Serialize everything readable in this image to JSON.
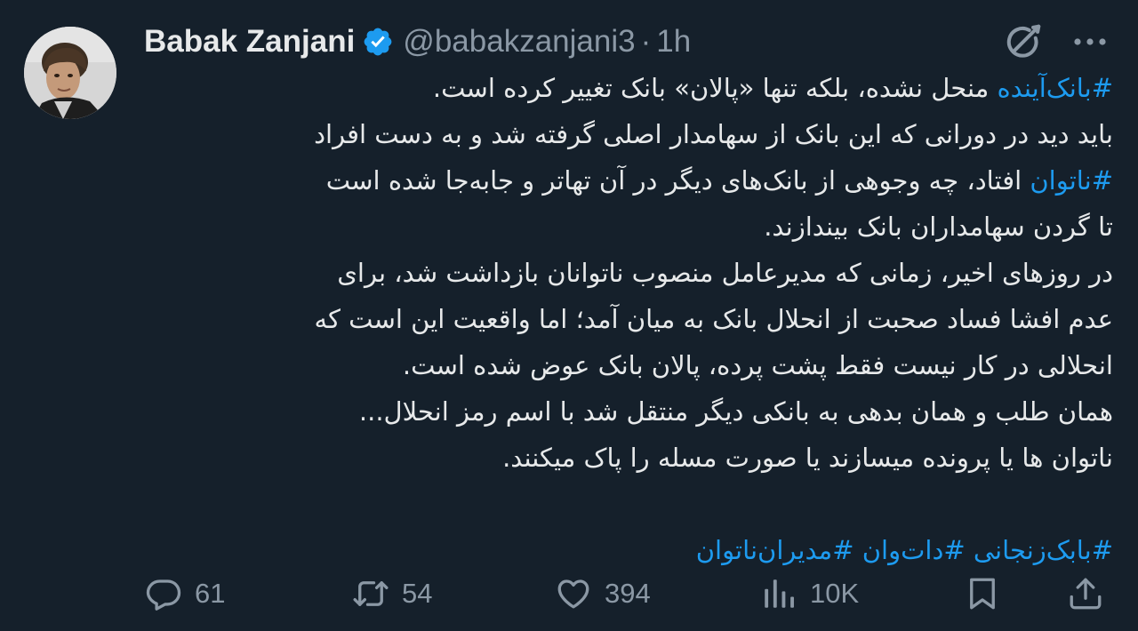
{
  "author": {
    "name": "Babak Zanjani",
    "handle": "@babakzanjani3",
    "separator": "·",
    "time": "1h",
    "verified": true
  },
  "tweet": {
    "lines": [
      [
        {
          "t": "#بانک‌آینده",
          "tag": true
        },
        {
          "t": " منحل نشده، بلکه تنها «پالان» بانک تغییر کرده است."
        }
      ],
      [
        {
          "t": "باید دید در دورانی که این بانک از سهامدار اصلی گرفته شد و به دست افراد"
        }
      ],
      [
        {
          "t": "#ناتوان",
          "tag": true
        },
        {
          "t": " افتاد، چه وجوهی از بانک‌های دیگر در آن تهاتر و جابه‌جا شده است"
        }
      ],
      [
        {
          "t": "تا گردن سهامداران بانک بیندازند."
        }
      ],
      [
        {
          "t": "در روزهای اخیر، زمانی که مدیرعامل منصوب ناتوانان بازداشت شد، برای"
        }
      ],
      [
        {
          "t": "عدم افشا فساد صحبت از انحلال بانک به میان آمد؛ اما واقعیت این است که"
        }
      ],
      [
        {
          "t": "انحلالی در کار نیست فقط پشت پرده، پالان بانک عوض شده است."
        }
      ],
      [
        {
          "t": "همان طلب و همان بدهی به بانکی دیگر منتقل شد  با اسم رمز انحلال..."
        }
      ],
      [
        {
          "t": "ناتوان ها یا پرونده میسازند یا صورت مسله را پاک میکنند."
        }
      ],
      [],
      [
        {
          "t": "#بابک‌زنجانی",
          "tag": true
        },
        {
          "t": " "
        },
        {
          "t": "#دات‌وان",
          "tag": true
        },
        {
          "t": " "
        },
        {
          "t": "#مدیران‌ناتوان",
          "tag": true
        }
      ]
    ]
  },
  "actions": {
    "replies": "61",
    "reposts": "54",
    "likes": "394",
    "views": "10K"
  },
  "icons": {
    "verified": "verified-badge-icon",
    "grok": "grok-icon",
    "more": "more-icon",
    "reply": "reply-icon",
    "repost": "repost-icon",
    "like": "heart-icon",
    "views": "views-icon",
    "bookmark": "bookmark-icon",
    "share": "share-icon"
  },
  "colors": {
    "background": "#15202b",
    "text": "#e7e9ea",
    "secondary": "#8b98a5",
    "accent": "#1d9bf0"
  }
}
